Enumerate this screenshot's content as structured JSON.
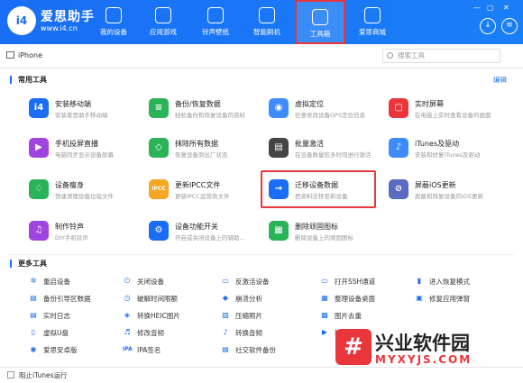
{
  "header": {
    "logo_text": "i4",
    "brand": "爱思助手",
    "url": "www.i4.cn",
    "nav": [
      {
        "label": "我的设备",
        "icon": "apple-icon"
      },
      {
        "label": "应用游戏",
        "icon": "app-store-icon"
      },
      {
        "label": "铃声壁纸",
        "icon": "music-icon"
      },
      {
        "label": "智能刷机",
        "icon": "flash-icon"
      },
      {
        "label": "工具箱",
        "icon": "toolbox-icon",
        "active": true
      },
      {
        "label": "爱思商城",
        "icon": "shop-bag-icon"
      }
    ],
    "download_icon": "↓",
    "menu_icon": "≡"
  },
  "subbar": {
    "device_name": "iPhone",
    "search_placeholder": "搜索工具"
  },
  "common_tools": {
    "title": "常用工具",
    "edit_label": "编辑",
    "items": [
      {
        "name": "安装移动端",
        "desc": "安装爱思助手移动端",
        "color": "#1a6ef5",
        "glyph": "i4"
      },
      {
        "name": "备份/恢复数据",
        "desc": "轻松备份和恢复设备的资料",
        "color": "#2bb35a",
        "glyph": "≡"
      },
      {
        "name": "虚拟定位",
        "desc": "任意修改设备GPS定位信息",
        "color": "#3d8bff",
        "glyph": "◉"
      },
      {
        "name": "实时屏幕",
        "desc": "在电脑上实时查看设备的画面",
        "color": "#e8363b",
        "glyph": "▢"
      },
      {
        "name": "手机投屏直播",
        "desc": "电脑同步显示设备屏幕",
        "color": "#a044e0",
        "glyph": "▶"
      },
      {
        "name": "抹除所有数据",
        "desc": "恢复设备到出厂状态",
        "color": "#2bb35a",
        "glyph": "◇"
      },
      {
        "name": "批量激活",
        "desc": "在设备数量较多时同进行激活",
        "color": "#444444",
        "glyph": "▤"
      },
      {
        "name": "iTunes及驱动",
        "desc": "安装和修复iTunes及驱动",
        "color": "#3d8bff",
        "glyph": "♪"
      },
      {
        "name": "设备瘦身",
        "desc": "快速清理设备垃圾文件",
        "color": "#2bb35a",
        "glyph": "♢"
      },
      {
        "name": "更新IPCC文件",
        "desc": "更新IPCC运营商文件",
        "color": "#f5a623",
        "glyph": "IPCC"
      },
      {
        "name": "迁移设备数据",
        "desc": "把资料迁移至新设备",
        "color": "#1a6ef5",
        "glyph": "→"
      },
      {
        "name": "屏蔽iOS更新",
        "desc": "屏蔽和恢复设备的iOS更新",
        "color": "#5b6bc0",
        "glyph": "⊘"
      },
      {
        "name": "制作铃声",
        "desc": "DIY手机铃声",
        "color": "#a044e0",
        "glyph": "♫"
      },
      {
        "name": "设备功能开关",
        "desc": "开启或关闭设备上的辅助...",
        "color": "#1a6ef5",
        "glyph": "⚙"
      },
      {
        "name": "删除顽固图标",
        "desc": "删除设备上的顽固图标",
        "color": "#2bb35a",
        "glyph": "▦"
      }
    ]
  },
  "more_tools": {
    "title": "更多工具",
    "items": [
      {
        "name": "重启设备",
        "glyph": "✲"
      },
      {
        "name": "关闭设备",
        "glyph": "⏻"
      },
      {
        "name": "反激活设备",
        "glyph": "▭"
      },
      {
        "name": "打开SSH通道",
        "glyph": "▭"
      },
      {
        "name": "进入恢复模式",
        "glyph": "▮"
      },
      {
        "name": "备份引导区数据",
        "glyph": "▤"
      },
      {
        "name": "破解时间限额",
        "glyph": "◷"
      },
      {
        "name": "崩溃分析",
        "glyph": "◆"
      },
      {
        "name": "整理设备桌面",
        "glyph": "▦"
      },
      {
        "name": "修复应用弹窗",
        "glyph": "▣"
      },
      {
        "name": "实时日志",
        "glyph": "▤"
      },
      {
        "name": "转换HEIC图片",
        "glyph": "◈"
      },
      {
        "name": "压缩照片",
        "glyph": "▨"
      },
      {
        "name": "图片去重",
        "glyph": "▩"
      },
      {
        "name": "",
        "glyph": ""
      },
      {
        "name": "虚拟U盘",
        "glyph": "▯"
      },
      {
        "name": "修改音频",
        "glyph": "♬"
      },
      {
        "name": "转换音频",
        "glyph": "♪"
      },
      {
        "name": "转换视频",
        "glyph": "▶"
      },
      {
        "name": "",
        "glyph": ""
      },
      {
        "name": "爱思安卓版",
        "glyph": "◉"
      },
      {
        "name": "IPA签名",
        "glyph": "IPA"
      },
      {
        "name": "社交软件备份",
        "glyph": "▤"
      },
      {
        "name": "",
        "glyph": ""
      },
      {
        "name": "",
        "glyph": ""
      }
    ]
  },
  "footer": {
    "checkbox_label": "阻止iTunes运行"
  },
  "watermark": {
    "logo": "#",
    "title": "兴业软件园",
    "url": "MYXYJS.COM"
  }
}
